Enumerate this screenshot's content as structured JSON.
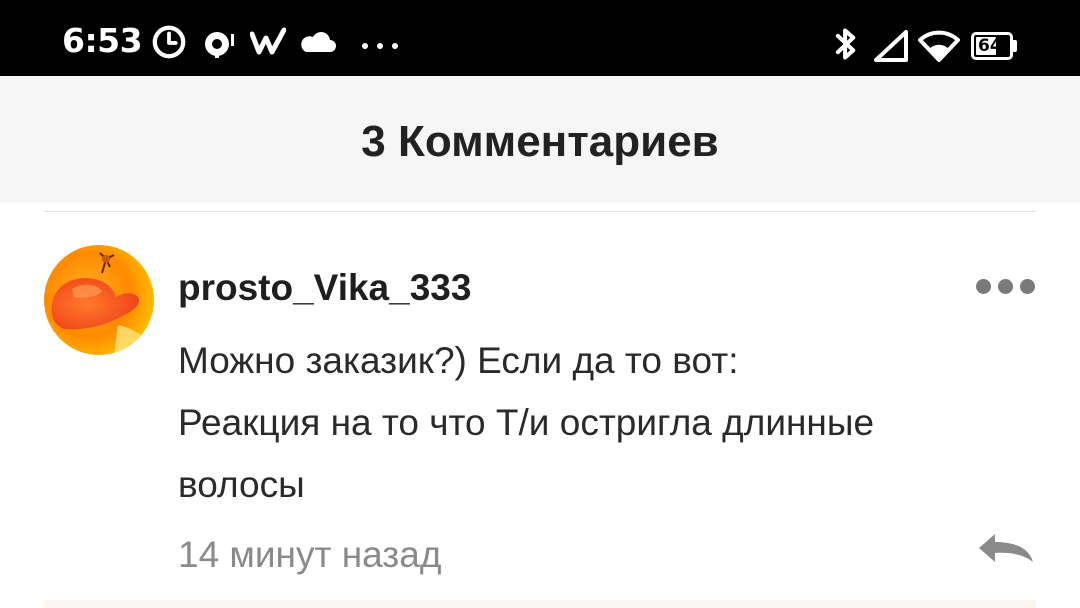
{
  "status_bar": {
    "time": "6:53",
    "icons": [
      "alarm-clock-icon",
      "screen-record-icon",
      "w-app-icon",
      "cloud-icon",
      "more-notifications-icon",
      "bluetooth-icon",
      "cellular-signal-icon",
      "wifi-icon",
      "battery-icon"
    ],
    "battery_level": "64",
    "battery_fraction": 0.64
  },
  "header": {
    "title": "3 Комментариев"
  },
  "comment": {
    "username": "prosto_Vika_333",
    "text": "Можно заказик?) Если да то вот:\nРеакция на то что Т/и остригла длинные волосы",
    "timestamp": "14 минут назад",
    "avatar_icon": "avatar-orange-hand-image",
    "more_icon": "more-dots-icon",
    "reply_icon": "reply-arrow-icon"
  },
  "colors": {
    "status_bar_bg": "#000000",
    "header_bg": "#f6f6f6",
    "text_primary": "#222222",
    "text_secondary": "#8a8a8a",
    "icon_gray": "#7a7a7a"
  }
}
